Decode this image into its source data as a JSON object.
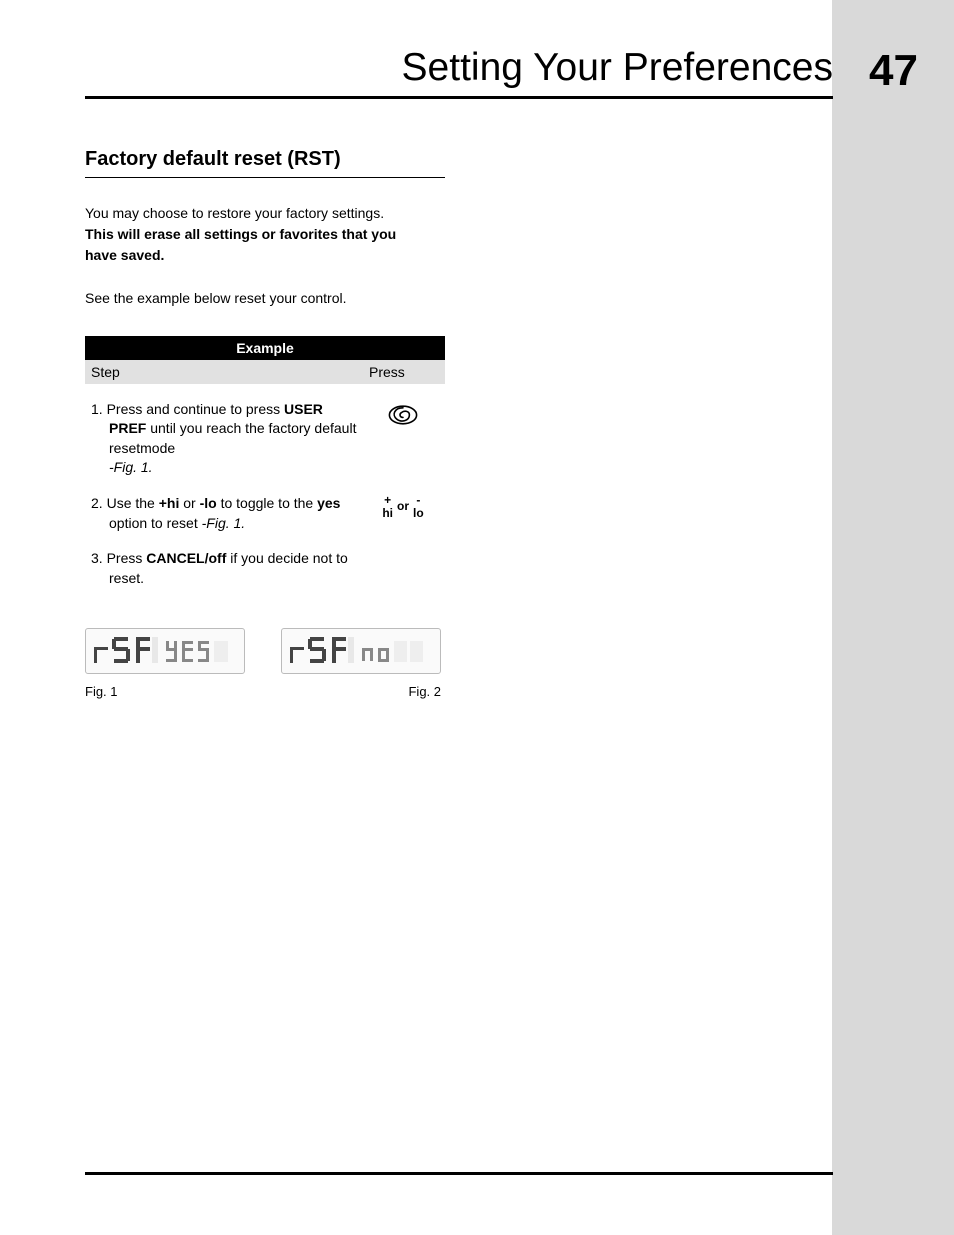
{
  "header": {
    "title": "Setting Your Preferences",
    "page_number": "47"
  },
  "section": {
    "title": "Factory default reset (RST)",
    "intro_line1": "You may choose to restore your factory settings.",
    "intro_bold1": "This will erase all settings or favorites that you",
    "intro_bold2": "have saved.",
    "see_line": "See the example below reset your control."
  },
  "example": {
    "header": "Example",
    "col_step": "Step",
    "col_press": "Press",
    "step1": {
      "num": "1.",
      "t1": "Press and continue to press ",
      "b1": "USER PREF",
      "t2": " until you reach the factory default resetmode ",
      "fig": "-Fig. 1.",
      "icon": "spiral-user-pref-icon"
    },
    "step2": {
      "num": "2.",
      "t1": "Use the ",
      "b1": "+hi",
      "t2": " or ",
      "b2": "-lo",
      "t3": " to toggle to the ",
      "b3": "yes",
      "t4": " option to reset ",
      "fig": "-Fig. 1.",
      "plus": "+",
      "hi": "hi",
      "or": "or",
      "minus": "-",
      "lo": "lo"
    },
    "step3": {
      "num": "3.",
      "t1": "Press ",
      "b1": "CANCEL/off",
      "t2": " if you decide not to reset."
    }
  },
  "figures": {
    "fig1": {
      "display_left": "rSt",
      "display_right": "YES",
      "label": "Fig. 1"
    },
    "fig2": {
      "display_left": "rSt",
      "display_right": "no",
      "label": "Fig. 2"
    }
  }
}
